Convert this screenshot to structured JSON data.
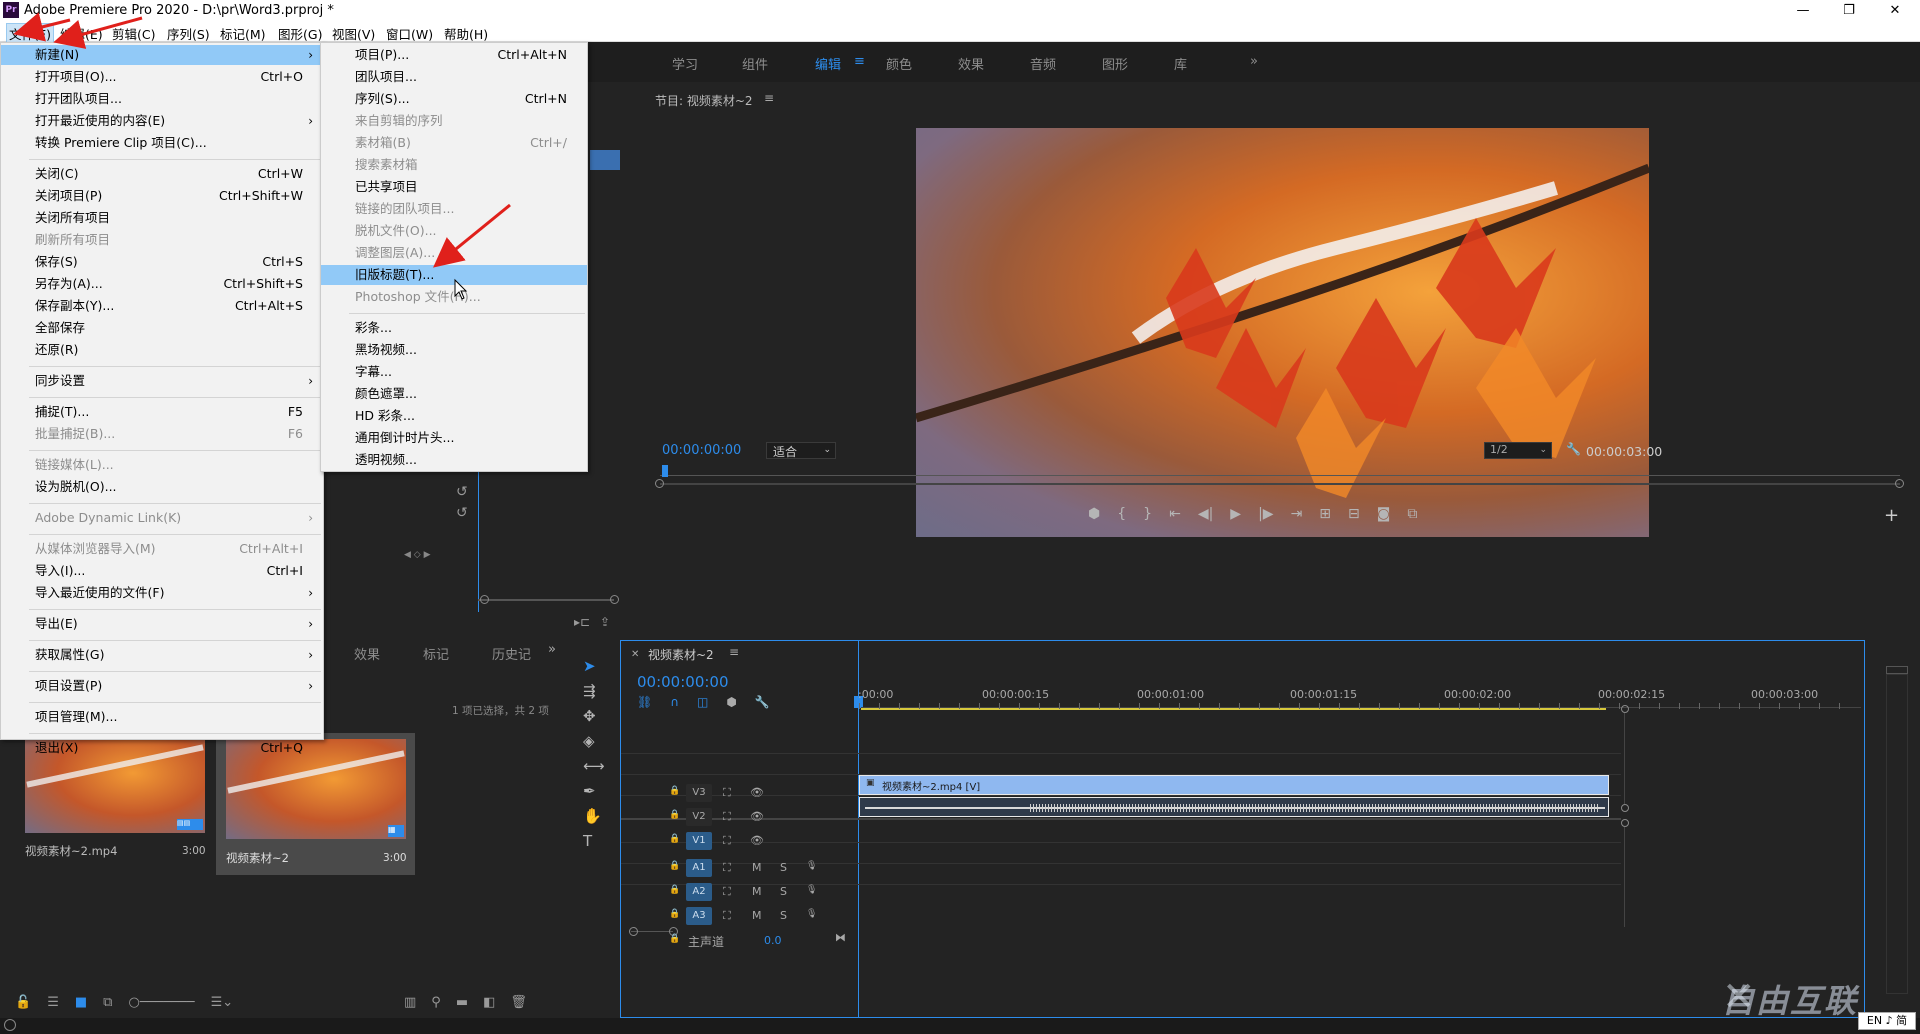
{
  "app": {
    "title": "Adobe Premiere Pro 2020 - D:\\pr\\Word3.prproj *",
    "logo": "Pr",
    "window_controls": [
      "—",
      "❐",
      "✕"
    ]
  },
  "menubar": [
    "文件(F)",
    "编辑(E)",
    "剪辑(C)",
    "序列(S)",
    "标记(M)",
    "图形(G)",
    "视图(V)",
    "窗口(W)",
    "帮助(H)"
  ],
  "workspace_tabs": [
    "学习",
    "组件",
    "编辑",
    "颜色",
    "效果",
    "音频",
    "图形",
    "库"
  ],
  "active_workspace": "编辑",
  "file_menu": [
    {
      "label": "新建(N)",
      "sc": "",
      "arrow": true,
      "hl": true
    },
    {
      "label": "打开项目(O)...",
      "sc": "Ctrl+O"
    },
    {
      "label": "打开团队项目..."
    },
    {
      "label": "打开最近使用的内容(E)",
      "arrow": true
    },
    {
      "label": "转换 Premiere Clip 项目(C)..."
    },
    {
      "sep": true
    },
    {
      "label": "关闭(C)",
      "sc": "Ctrl+W"
    },
    {
      "label": "关闭项目(P)",
      "sc": "Ctrl+Shift+W"
    },
    {
      "label": "关闭所有项目"
    },
    {
      "label": "刷新所有项目",
      "dis": true
    },
    {
      "label": "保存(S)",
      "sc": "Ctrl+S"
    },
    {
      "label": "另存为(A)...",
      "sc": "Ctrl+Shift+S"
    },
    {
      "label": "保存副本(Y)...",
      "sc": "Ctrl+Alt+S"
    },
    {
      "label": "全部保存"
    },
    {
      "label": "还原(R)"
    },
    {
      "sep": true
    },
    {
      "label": "同步设置",
      "arrow": true
    },
    {
      "sep": true
    },
    {
      "label": "捕捉(T)...",
      "sc": "F5"
    },
    {
      "label": "批量捕捉(B)...",
      "sc": "F6",
      "dis": true
    },
    {
      "sep": true
    },
    {
      "label": "链接媒体(L)...",
      "dis": true
    },
    {
      "label": "设为脱机(O)..."
    },
    {
      "sep": true
    },
    {
      "label": "Adobe Dynamic Link(K)",
      "arrow": true,
      "dis": true
    },
    {
      "sep": true
    },
    {
      "label": "从媒体浏览器导入(M)",
      "sc": "Ctrl+Alt+I",
      "dis": true
    },
    {
      "label": "导入(I)...",
      "sc": "Ctrl+I"
    },
    {
      "label": "导入最近使用的文件(F)",
      "arrow": true
    },
    {
      "sep": true
    },
    {
      "label": "导出(E)",
      "arrow": true
    },
    {
      "sep": true
    },
    {
      "label": "获取属性(G)",
      "arrow": true
    },
    {
      "sep": true
    },
    {
      "label": "项目设置(P)",
      "arrow": true
    },
    {
      "sep": true
    },
    {
      "label": "项目管理(M)..."
    },
    {
      "sep": true
    },
    {
      "label": "退出(X)",
      "sc": "Ctrl+Q"
    }
  ],
  "new_submenu": [
    {
      "label": "项目(P)...",
      "sc": "Ctrl+Alt+N"
    },
    {
      "label": "团队项目..."
    },
    {
      "label": "序列(S)...",
      "sc": "Ctrl+N"
    },
    {
      "label": "来自剪辑的序列",
      "dis": true
    },
    {
      "label": "素材箱(B)",
      "sc": "Ctrl+/",
      "dis": true
    },
    {
      "label": "搜索素材箱",
      "dis": true
    },
    {
      "label": "已共享项目"
    },
    {
      "label": "链接的团队项目...",
      "dis": true
    },
    {
      "label": "脱机文件(O)...",
      "dis": true
    },
    {
      "label": "调整图层(A)...",
      "dis": true
    },
    {
      "label": "旧版标题(T)...",
      "hl": true
    },
    {
      "label": "Photoshop 文件(H)...",
      "dis": true
    },
    {
      "sep": true
    },
    {
      "label": "彩条..."
    },
    {
      "label": "黑场视频..."
    },
    {
      "label": "字幕..."
    },
    {
      "label": "颜色遮罩..."
    },
    {
      "label": "HD 彩条..."
    },
    {
      "label": "通用倒计时片头..."
    },
    {
      "label": "透明视频..."
    }
  ],
  "program": {
    "title": "节目: 视频素材~2",
    "timecode": "00:00:00:00",
    "fit": "适合",
    "resolution": "1/2",
    "duration": "00:00:03:00"
  },
  "project": {
    "tabs": [
      "效果",
      "标记",
      "历史记"
    ],
    "selection": "1 项已选择，共 2 项",
    "items": [
      {
        "name": "视频素材~2.mp4",
        "dur": "3:00"
      },
      {
        "name": "视频素材~2",
        "dur": "3:00"
      }
    ]
  },
  "timeline": {
    "title": "视频素材~2",
    "timecode": "00:00:00:00",
    "ruler": [
      ":00:00",
      "00:00:00:15",
      "00:00:01:00",
      "00:00:01:15",
      "00:00:02:00",
      "00:00:02:15",
      "00:00:03:00"
    ],
    "tracks": [
      "V3",
      "V2",
      "V1",
      "A1",
      "A2",
      "A3"
    ],
    "master": "主声道",
    "master_val": "0.0",
    "clip_v": "视频素材~2.mp4 [V]"
  },
  "watermark": "自由互联",
  "ime": "EN ♪ 简",
  "colors": {
    "accent": "#2d8ceb",
    "menu_hl": "#91c9f7",
    "clip_video": "#8fb8f0",
    "arrow": "#e0201b"
  }
}
